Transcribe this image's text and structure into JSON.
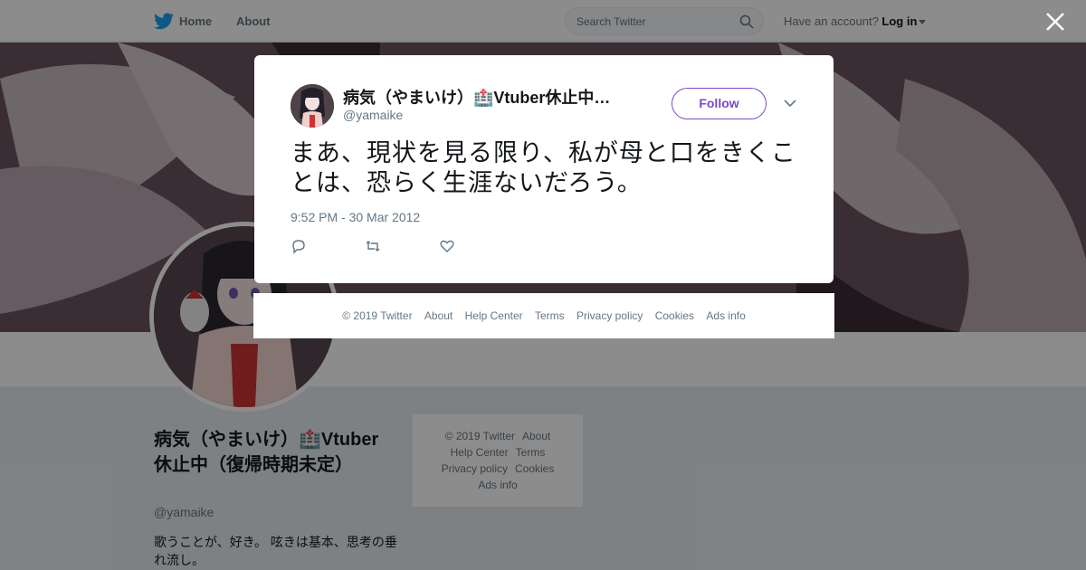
{
  "nav": {
    "home_label": "Home",
    "about_label": "About",
    "search_placeholder": "Search Twitter",
    "account_prompt": "Have an account?",
    "login_label": "Log in"
  },
  "profile": {
    "name": "病気（やまいけ）🏥Vtuber休止中（復帰時期未定）",
    "handle": "@yamaike",
    "bio": "歌うことが、好き。 呟きは基本、思考の垂れ流し。"
  },
  "side_footer": [
    "© 2019 Twitter",
    "About",
    "Help Center",
    "Terms",
    "Privacy policy",
    "Cookies",
    "Ads info"
  ],
  "tweet": {
    "author_name": "病気（やまいけ）🏥Vtuber休止中…",
    "author_handle": "@yamaike",
    "follow_label": "Follow",
    "text": "まあ、現状を見る限り、私が母と口をきくことは、恐らく生涯ないだろう。",
    "timestamp": "9:52 PM - 30 Mar 2012"
  },
  "modal_footer": [
    "© 2019 Twitter",
    "About",
    "Help Center",
    "Terms",
    "Privacy policy",
    "Cookies",
    "Ads info"
  ],
  "colors": {
    "accent": "#794bc4",
    "twitter_blue": "#1da1f2"
  },
  "icons": [
    "twitter-bird-icon",
    "search-icon",
    "close-icon",
    "chevron-down-icon",
    "reply-icon",
    "retweet-icon",
    "like-icon"
  ]
}
